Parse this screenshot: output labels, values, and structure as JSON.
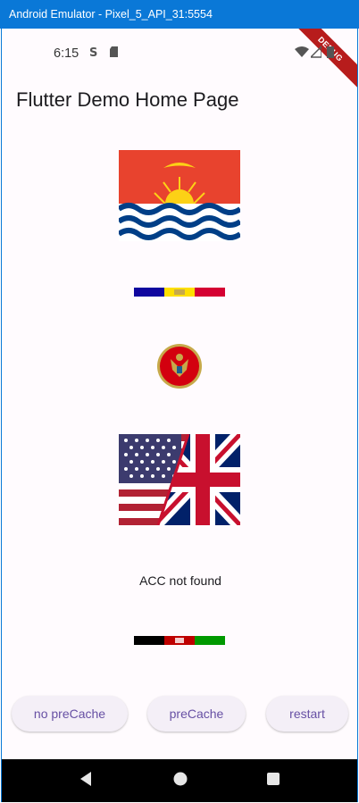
{
  "window": {
    "title": "Android Emulator - Pixel_5_API_31:5554"
  },
  "status_bar": {
    "time": "6:15",
    "icons": [
      "notification-s-icon",
      "sd-card-icon",
      "wifi-icon",
      "signal-icon",
      "battery-icon"
    ]
  },
  "debug_banner": {
    "label": "DEBUG"
  },
  "app_bar": {
    "title": "Flutter Demo Home Page"
  },
  "flags": [
    {
      "name": "kiribati-flag"
    },
    {
      "name": "andorra-flag"
    },
    {
      "name": "montenegro-flag-circle"
    },
    {
      "name": "usa-uk-flag"
    },
    {
      "name": "afghanistan-flag"
    }
  ],
  "message": "ACC not found",
  "buttons": {
    "no_precache": "no preCache",
    "precache": "preCache",
    "restart": "restart"
  },
  "colors": {
    "accent": "#6750a4",
    "title_bar": "#0a78d7",
    "background": "#fffbfe"
  }
}
